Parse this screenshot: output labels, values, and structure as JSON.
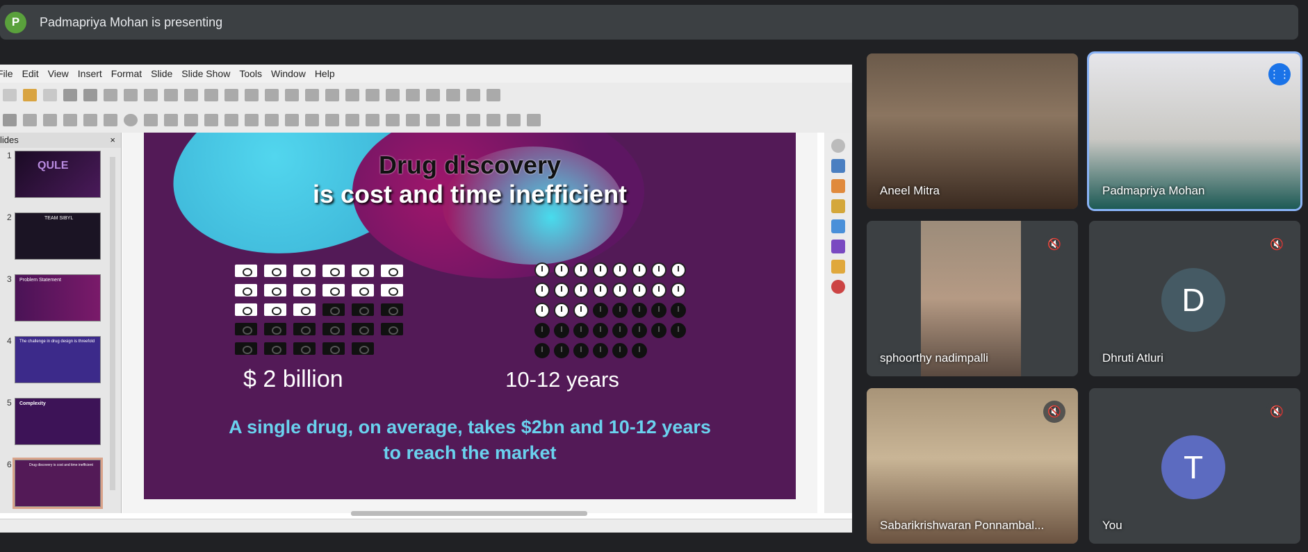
{
  "meet": {
    "presenter_initial": "P",
    "presenting_label": "Padmapriya Mohan is presenting"
  },
  "impress": {
    "menu": [
      "File",
      "Edit",
      "View",
      "Insert",
      "Format",
      "Slide",
      "Slide Show",
      "Tools",
      "Window",
      "Help"
    ],
    "slides_panel_title": "lides",
    "slides_close": "×",
    "thumbnails": [
      {
        "num": "1",
        "text": "QULE"
      },
      {
        "num": "2",
        "text": "TEAM SIBYL"
      },
      {
        "num": "3",
        "text": "Problem Statement"
      },
      {
        "num": "4",
        "text": "The challenge in drug design is threefold"
      },
      {
        "num": "5",
        "text": "Complexity"
      },
      {
        "num": "6",
        "text": "Drug discovery is cost and time inefficient"
      }
    ]
  },
  "slide": {
    "title_line1": "Drug discovery",
    "title_line2": "is cost and time inefficient",
    "money_stat": "$ 2 billion",
    "time_stat": "10-12 years",
    "caption_line1": "A single drug, on average, takes $2bn and 10-12 years",
    "caption_line2": "to reach the market",
    "money_filled": 15,
    "money_total": 29,
    "clock_filled": 19,
    "clock_total": 38
  },
  "participants": [
    {
      "name": "Aneel Mitra",
      "muted": false,
      "initial": ""
    },
    {
      "name": "Padmapriya Mohan",
      "muted": false,
      "initial": ""
    },
    {
      "name": "sphoorthy nadimpalli",
      "muted": true,
      "initial": ""
    },
    {
      "name": "Dhruti Atluri",
      "muted": true,
      "initial": "D"
    },
    {
      "name": "Sabarikrishwaran Ponnambal...",
      "muted": true,
      "initial": ""
    },
    {
      "name": "You",
      "muted": true,
      "initial": "T"
    }
  ],
  "colors": {
    "slide_bg": "#531a57",
    "caption": "#6ad2ee",
    "avatar_d": "#455a64",
    "avatar_t": "#5c6bc0",
    "speaking": "#1a73e8",
    "active_outline": "#8ab4f8"
  }
}
